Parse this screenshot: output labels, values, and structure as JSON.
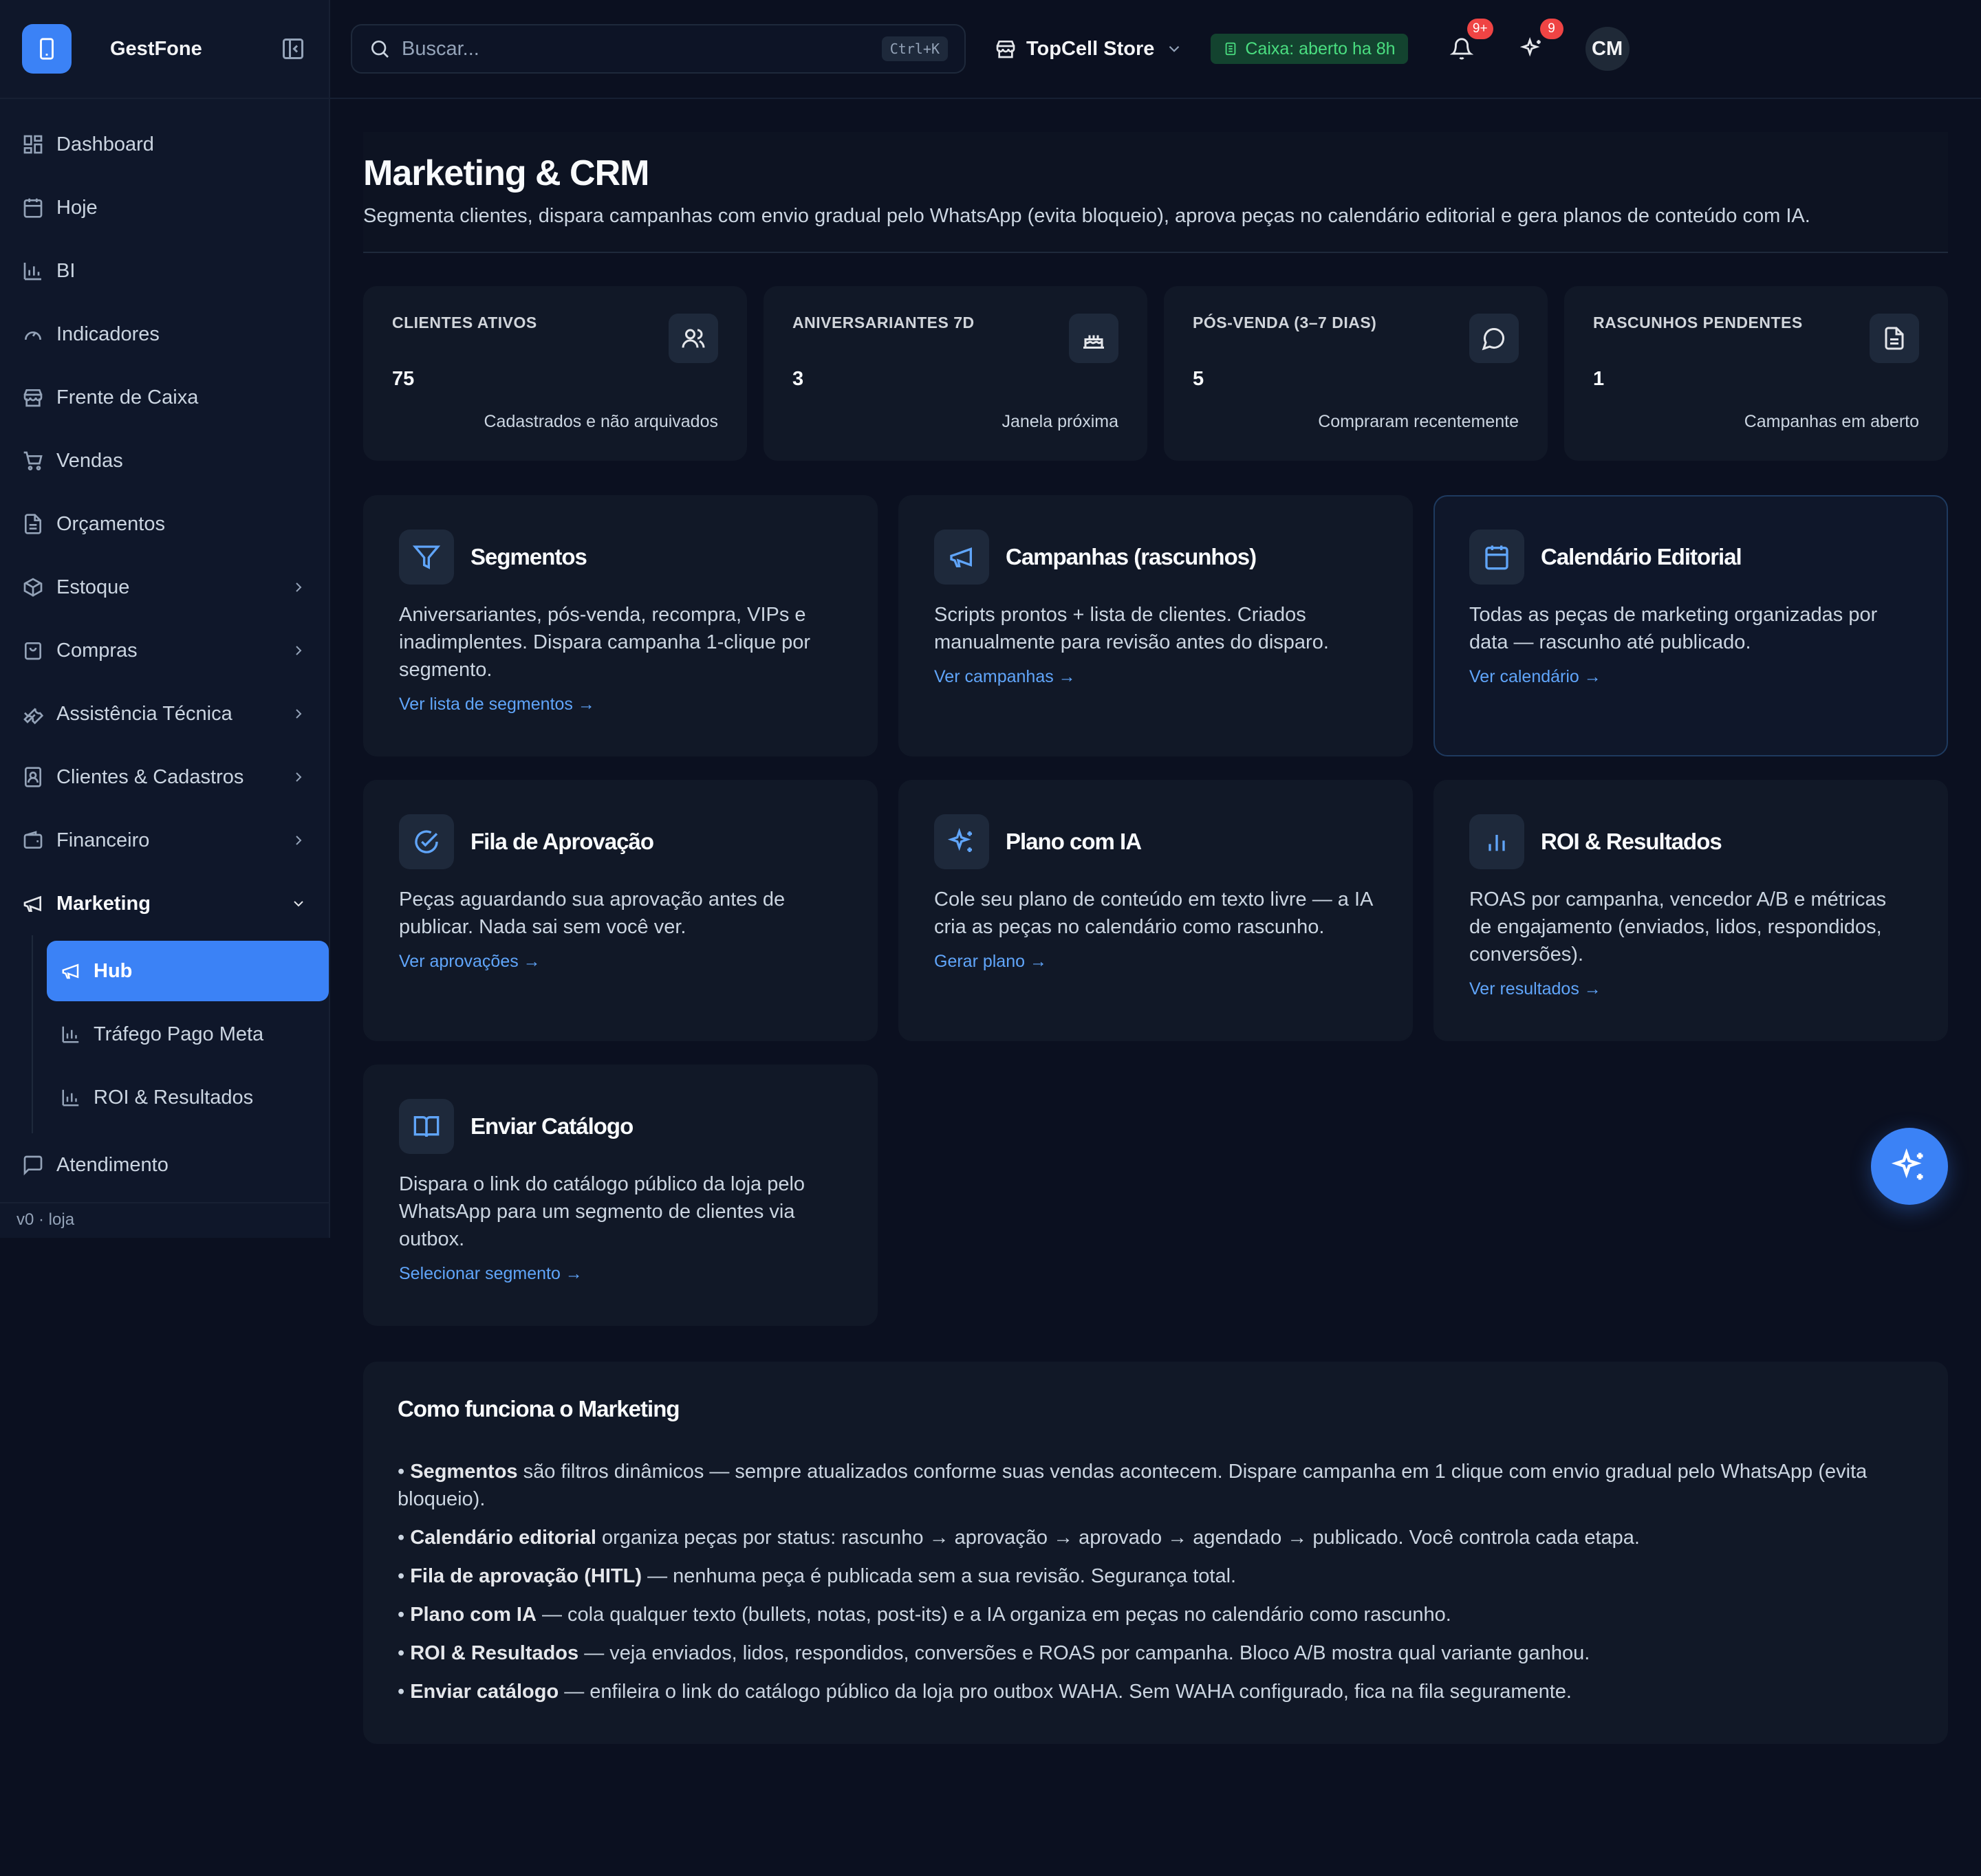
{
  "brand": {
    "name": "GestFone"
  },
  "sidebar": {
    "items": [
      {
        "label": "Dashboard",
        "icon": "dashboard-icon"
      },
      {
        "label": "Hoje",
        "icon": "calendar-icon"
      },
      {
        "label": "BI",
        "icon": "bar-chart-icon"
      },
      {
        "label": "Indicadores",
        "icon": "gauge-icon"
      },
      {
        "label": "Frente de Caixa",
        "icon": "store-icon"
      },
      {
        "label": "Vendas",
        "icon": "cart-icon"
      },
      {
        "label": "Orçamentos",
        "icon": "document-icon"
      },
      {
        "label": "Estoque",
        "icon": "package-icon"
      },
      {
        "label": "Compras",
        "icon": "shopping-bag-icon"
      },
      {
        "label": "Assistência Técnica",
        "icon": "wrench-icon"
      },
      {
        "label": "Clientes & Cadastros",
        "icon": "contact-icon"
      },
      {
        "label": "Financeiro",
        "icon": "wallet-icon"
      },
      {
        "label": "Marketing",
        "icon": "megaphone-icon"
      }
    ],
    "marketing_sub": [
      {
        "label": "Hub",
        "icon": "megaphone-icon"
      },
      {
        "label": "Tráfego Pago Meta",
        "icon": "bar-chart-icon"
      },
      {
        "label": "ROI & Resultados",
        "icon": "bar-chart-icon"
      }
    ],
    "atendimento": {
      "label": "Atendimento",
      "icon": "chat-icon"
    },
    "footer": "v0 · loja"
  },
  "topbar": {
    "search_placeholder": "Buscar...",
    "shortcut": "Ctrl+K",
    "store": "TopCell Store",
    "caixa_status": "Caixa: aberto ha 8h",
    "notifications_badge": "9+",
    "ai_badge": "9",
    "avatar_initials": "CM"
  },
  "page": {
    "title": "Marketing & CRM",
    "subtitle": "Segmenta clientes, dispara campanhas com envio gradual pelo WhatsApp (evita bloqueio), aprova peças no calendário editorial e gera planos de conteúdo com IA."
  },
  "stats": [
    {
      "title": "CLIENTES ATIVOS",
      "value": "75",
      "sub": "Cadastrados e não arquivados",
      "icon": "users-icon"
    },
    {
      "title": "ANIVERSARIANTES 7D",
      "value": "3",
      "sub": "Janela próxima",
      "icon": "cake-icon"
    },
    {
      "title": "PÓS-VENDA (3–7 DIAS)",
      "value": "5",
      "sub": "Compraram recentemente",
      "icon": "chat-icon"
    },
    {
      "title": "RASCUNHOS PENDENTES",
      "value": "1",
      "sub": "Campanhas em aberto",
      "icon": "file-icon"
    }
  ],
  "cards": [
    {
      "title": "Segmentos",
      "desc": "Aniversariantes, pós-venda, recompra, VIPs e inadimplentes. Dispara campanha 1-clique por segmento.",
      "link": "Ver lista de segmentos →",
      "icon": "filter-icon"
    },
    {
      "title": "Campanhas (rascunhos)",
      "desc": "Scripts prontos + lista de clientes. Criados manualmente para revisão antes do disparo.",
      "link": "Ver campanhas →",
      "icon": "megaphone-icon"
    },
    {
      "title": "Calendário Editorial",
      "desc": "Todas as peças de marketing organizadas por data — rascunho até publicado.",
      "link": "Ver calendário →",
      "icon": "calendar-icon"
    },
    {
      "title": "Fila de Aprovação",
      "desc": "Peças aguardando sua aprovação antes de publicar. Nada sai sem você ver.",
      "link": "Ver aprovações →",
      "icon": "check-circle-icon"
    },
    {
      "title": "Plano com IA",
      "desc": "Cole seu plano de conteúdo em texto livre — a IA cria as peças no calendário como rascunho.",
      "link": "Gerar plano →",
      "icon": "sparkles-icon"
    },
    {
      "title": "ROI & Resultados",
      "desc": "ROAS por campanha, vencedor A/B e métricas de engajamento (enviados, lidos, respondidos, conversões).",
      "link": "Ver resultados →",
      "icon": "bar-chart-icon"
    },
    {
      "title": "Enviar Catálogo",
      "desc": "Dispara o link do catálogo público da loja pelo WhatsApp para um segmento de clientes via outbox.",
      "link": "Selecionar segmento →",
      "icon": "book-open-icon"
    }
  ],
  "howto": {
    "title": "Como funciona o Marketing",
    "items": [
      {
        "bold": "Segmentos",
        "text": " são filtros dinâmicos — sempre atualizados conforme suas vendas acontecem. Dispare campanha em 1 clique com envio gradual pelo WhatsApp (evita bloqueio)."
      },
      {
        "bold": "Calendário editorial",
        "text": " organiza peças por status: rascunho → aprovação → aprovado → agendado → publicado. Você controla cada etapa."
      },
      {
        "bold": "Fila de aprovação (HITL)",
        "text": " — nenhuma peça é publicada sem a sua revisão. Segurança total."
      },
      {
        "bold": "Plano com IA",
        "text": " — cola qualquer texto (bullets, notas, post-its) e a IA organiza em peças no calendário como rascunho."
      },
      {
        "bold": "ROI & Resultados",
        "text": " — veja enviados, lidos, respondidos, conversões e ROAS por campanha. Bloco A/B mostra qual variante ganhou."
      },
      {
        "bold": "Enviar catálogo",
        "text": " — enfileira o link do catálogo público da loja pro outbox WAHA. Sem WAHA configurado, fica na fila seguramente."
      }
    ]
  },
  "colors": {
    "accent": "#3b82f6",
    "link": "#60a5fa",
    "success": "#4ade80",
    "danger": "#ef4444"
  }
}
